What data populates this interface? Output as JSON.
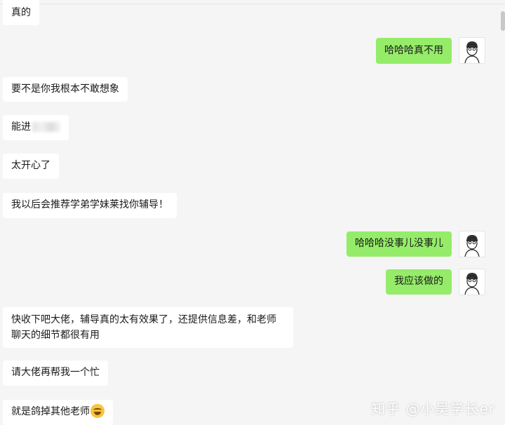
{
  "chat": {
    "messages": [
      {
        "side": "left",
        "text": "真的"
      },
      {
        "side": "right",
        "text": "哈哈哈真不用"
      },
      {
        "side": "left",
        "text": "要不是你我根本不敢想象"
      },
      {
        "side": "left",
        "text": "能进"
      },
      {
        "side": "left",
        "text": "太开心了"
      },
      {
        "side": "left",
        "text": "我以后会推荐学弟学妹莱找你辅导！"
      },
      {
        "side": "right",
        "text": "哈哈哈没事儿没事儿"
      },
      {
        "side": "right",
        "text": "我应该做的"
      },
      {
        "side": "left",
        "text": "快收下吧大佬，辅导真的太有效果了，还提供信息差，和老师聊天的细节都很有用"
      },
      {
        "side": "left",
        "text": "请大佬再帮我一个忙"
      },
      {
        "side": "left",
        "text": "就是鸽掉其他老师"
      }
    ]
  },
  "watermark": "知乎 @小吴学长er",
  "colors": {
    "background": "#f5f5f5",
    "received": "#ffffff",
    "sent": "#95ec69"
  },
  "icons": {
    "avatar": "sketch-avatar-icon",
    "blurred": "blurred-text",
    "emoji": "sweat-smile-emoji"
  }
}
